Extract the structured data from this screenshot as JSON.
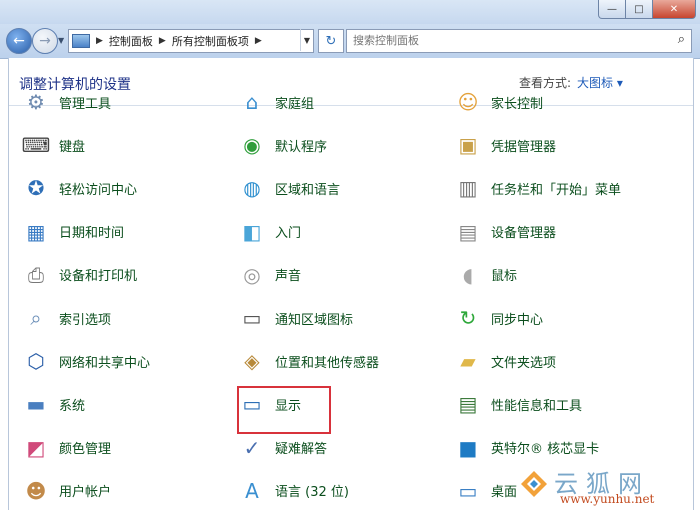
{
  "window": {
    "caption_buttons": {
      "minimize": "—",
      "maximize": "□",
      "close": "✕"
    }
  },
  "address_bar": {
    "breadcrumbs": [
      "控制面板",
      "所有控制面板项"
    ],
    "search_placeholder": "搜索控制面板"
  },
  "header": {
    "title": "调整计算机的设置",
    "view_by_label": "查看方式:",
    "view_by_value": "大图标 ▾"
  },
  "items": [
    {
      "label": "管理工具",
      "icon": "admin-tools-icon"
    },
    {
      "label": "家庭组",
      "icon": "homegroup-icon"
    },
    {
      "label": "家长控制",
      "icon": "parental-controls-icon"
    },
    {
      "label": "键盘",
      "icon": "keyboard-icon"
    },
    {
      "label": "默认程序",
      "icon": "default-programs-icon"
    },
    {
      "label": "凭据管理器",
      "icon": "credential-manager-icon"
    },
    {
      "label": "轻松访问中心",
      "icon": "ease-of-access-icon"
    },
    {
      "label": "区域和语言",
      "icon": "region-language-icon"
    },
    {
      "label": "任务栏和「开始」菜单",
      "icon": "taskbar-start-icon"
    },
    {
      "label": "日期和时间",
      "icon": "date-time-icon"
    },
    {
      "label": "入门",
      "icon": "getting-started-icon"
    },
    {
      "label": "设备管理器",
      "icon": "device-manager-icon"
    },
    {
      "label": "设备和打印机",
      "icon": "devices-printers-icon"
    },
    {
      "label": "声音",
      "icon": "sound-icon"
    },
    {
      "label": "鼠标",
      "icon": "mouse-icon"
    },
    {
      "label": "索引选项",
      "icon": "indexing-options-icon"
    },
    {
      "label": "通知区域图标",
      "icon": "notification-area-icon"
    },
    {
      "label": "同步中心",
      "icon": "sync-center-icon"
    },
    {
      "label": "网络和共享中心",
      "icon": "network-sharing-icon"
    },
    {
      "label": "位置和其他传感器",
      "icon": "location-sensors-icon"
    },
    {
      "label": "文件夹选项",
      "icon": "folder-options-icon"
    },
    {
      "label": "系统",
      "icon": "system-icon"
    },
    {
      "label": "显示",
      "icon": "display-icon"
    },
    {
      "label": "性能信息和工具",
      "icon": "performance-icon"
    },
    {
      "label": "颜色管理",
      "icon": "color-management-icon"
    },
    {
      "label": "疑难解答",
      "icon": "troubleshooting-icon"
    },
    {
      "label": "英特尔® 核芯显卡",
      "icon": "intel-graphics-icon"
    },
    {
      "label": "用户帐户",
      "icon": "user-accounts-icon"
    },
    {
      "label": "语言 (32 位)",
      "icon": "language-icon"
    },
    {
      "label": "桌面",
      "icon": "desktop-icon"
    }
  ],
  "highlighted_item": "显示",
  "watermark": {
    "text": "云狐网",
    "url": "www.yunhu.net"
  },
  "colors": {
    "item_text": "#0b4e1d",
    "heading": "#1e3287",
    "highlight_border": "#d8323b"
  }
}
